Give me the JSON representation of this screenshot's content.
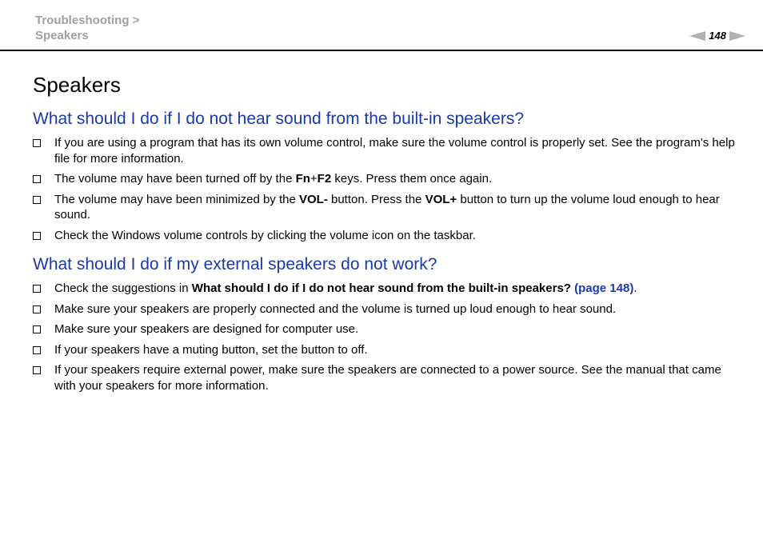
{
  "header": {
    "breadcrumb_1": "Troubleshooting >",
    "breadcrumb_2": "Speakers",
    "page_number": "148"
  },
  "title": "Speakers",
  "section1": {
    "heading": "What should I do if I do not hear sound from the built-in speakers?",
    "item1": "If you are using a program that has its own volume control, make sure the volume control is properly set. See the program's help file for more information.",
    "item2_a": "The volume may have been turned off by the ",
    "item2_b1": "Fn",
    "item2_plus": "+",
    "item2_b2": "F2",
    "item2_c": " keys. Press them once again.",
    "item3_a": "The volume may have been minimized by the ",
    "item3_b1": "VOL-",
    "item3_c": " button. Press the ",
    "item3_b2": "VOL+",
    "item3_d": " button to turn up the volume loud enough to hear sound.",
    "item4": "Check the Windows volume controls by clicking the volume icon on the taskbar."
  },
  "section2": {
    "heading": "What should I do if my external speakers do not work?",
    "item1_a": "Check the suggestions in ",
    "item1_b": "What should I do if I do not hear sound from the built-in speakers?",
    "item1_link": "(page 148)",
    "item1_end": ".",
    "item2": "Make sure your speakers are properly connected and the volume is turned up loud enough to hear sound.",
    "item3": "Make sure your speakers are designed for computer use.",
    "item4": "If your speakers have a muting button, set the button to off.",
    "item5": "If your speakers require external power, make sure the speakers are connected to a power source. See the manual that came with your speakers for more information."
  },
  "colors": {
    "heading": "#1a3aa8",
    "breadcrumb": "#a0a0a0",
    "pager_arrow": "#b0b0b0"
  }
}
